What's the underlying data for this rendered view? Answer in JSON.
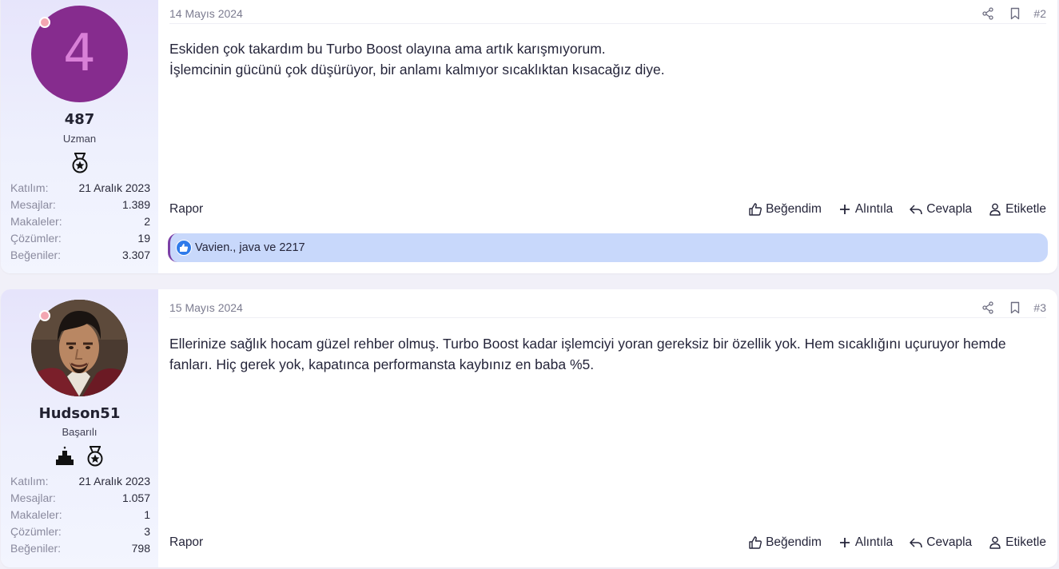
{
  "posts": [
    {
      "user": {
        "avatar_letter": "4",
        "avatar_color": "#862c8e",
        "name": "487",
        "title": "Uzman",
        "badges": [
          "medal-star-icon"
        ],
        "stats": [
          {
            "key": "Katılım:",
            "value": "21 Aralık 2023"
          },
          {
            "key": "Mesajlar:",
            "value": "1.389"
          },
          {
            "key": "Makaleler:",
            "value": "2"
          },
          {
            "key": "Çözümler:",
            "value": "19"
          },
          {
            "key": "Beğeniler:",
            "value": "3.307"
          }
        ]
      },
      "date": "14 Mayıs 2024",
      "number": "#2",
      "lines": [
        "Eskiden çok takardım bu Turbo Boost olayına ama artık karışmıyorum.",
        "İşlemcinin gücünü çok düşürüyor, bir anlamı kalmıyor sıcaklıktan kısacağız diye."
      ],
      "reactions": "Vavien., java ve 2217"
    },
    {
      "user": {
        "avatar_letter": "",
        "name": "Hudson51",
        "title": "Başarılı",
        "badges": [
          "podium-icon",
          "medal-star-icon"
        ],
        "stats": [
          {
            "key": "Katılım:",
            "value": "21 Aralık 2023"
          },
          {
            "key": "Mesajlar:",
            "value": "1.057"
          },
          {
            "key": "Makaleler:",
            "value": "1"
          },
          {
            "key": "Çözümler:",
            "value": "3"
          },
          {
            "key": "Beğeniler:",
            "value": "798"
          }
        ]
      },
      "date": "15 Mayıs 2024",
      "number": "#3",
      "lines": [
        "Ellerinize sağlık hocam güzel rehber olmuş. Turbo Boost kadar işlemciyi yoran gereksiz bir özellik yok. Hem sıcaklığını uçuruyor hemde fanları. Hiç gerek yok, kapatınca performansta kaybınız en baba %5."
      ]
    }
  ],
  "actions": {
    "report": "Rapor",
    "like": "Beğendim",
    "quote": "Alıntıla",
    "reply": "Cevapla",
    "tag": "Etiketle"
  },
  "colors": {
    "reaction_bar": "#c8d8fb",
    "online_dot": "#f3a6b1",
    "like_blue": "#2f7bea"
  }
}
